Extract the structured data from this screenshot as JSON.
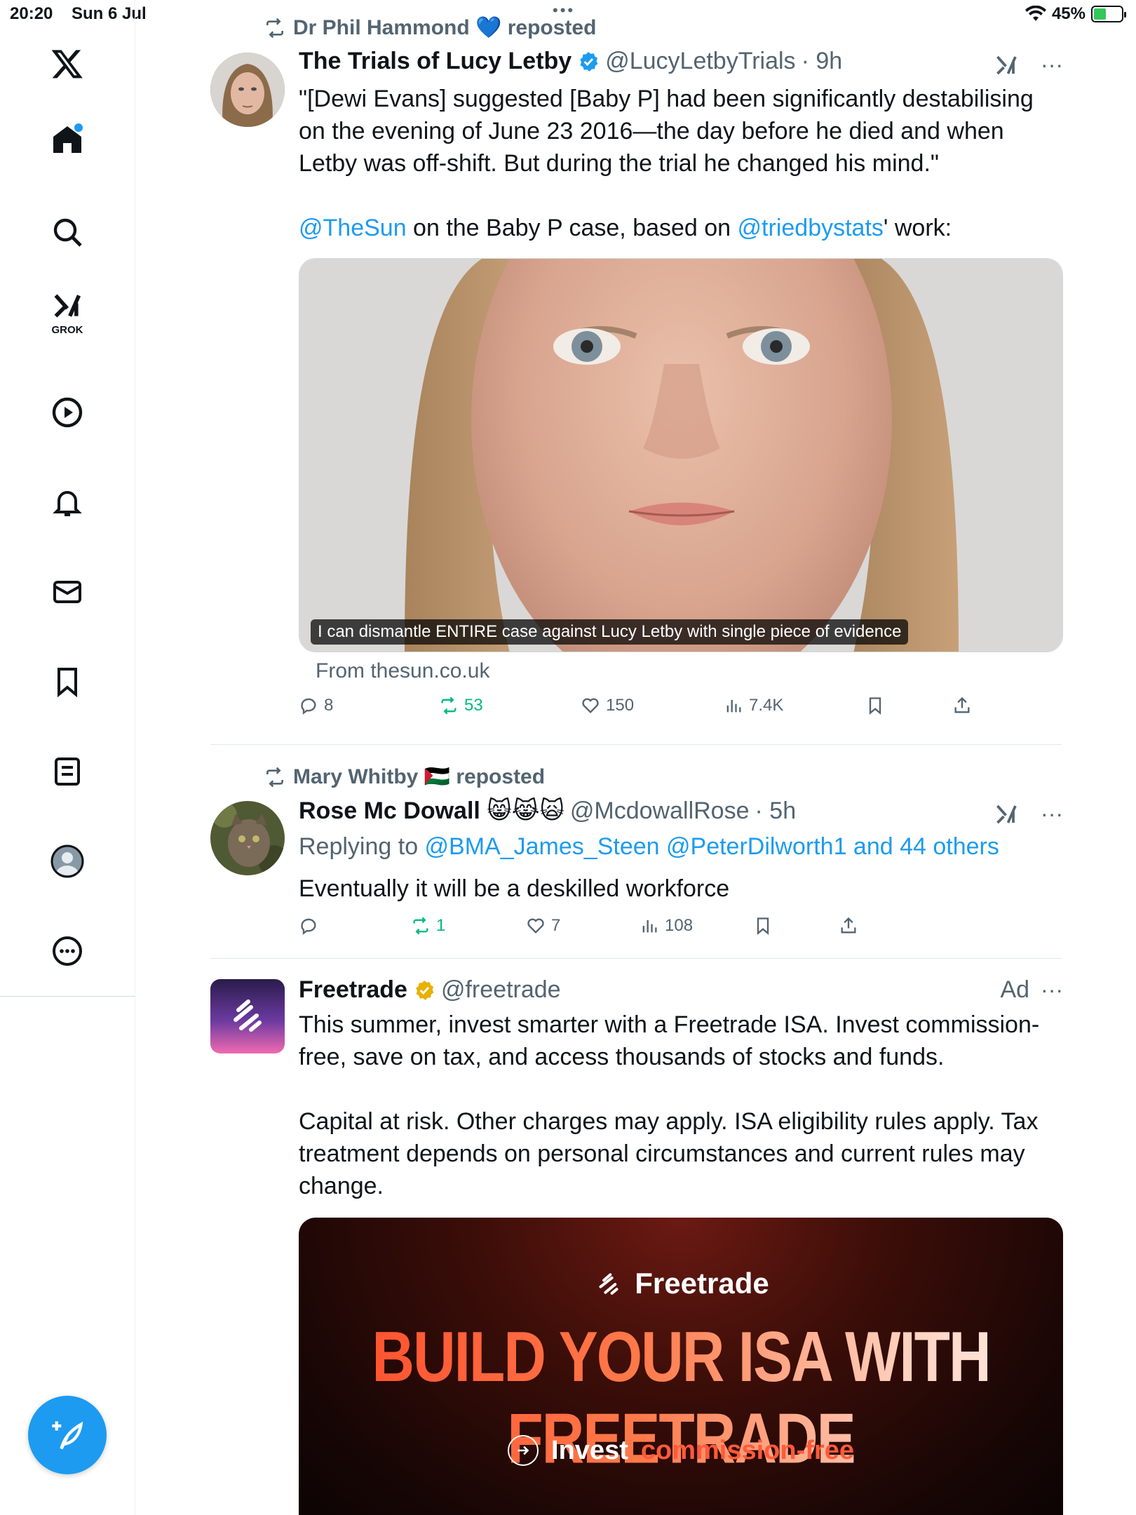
{
  "status_bar": {
    "time": "20:20",
    "date": "Sun 6 Jul",
    "battery": "45%",
    "battery_level": 0.45
  },
  "sidebar": {
    "grok_label": "GROK"
  },
  "tweets": [
    {
      "reposted_by": "Dr Phil Hammond 💙 reposted",
      "name": "The Trials of Lucy Letby",
      "handle": "@LucyLetbyTrials",
      "time": "· 9h",
      "text_line1": "\"[Dewi Evans] suggested [Baby P] had been significantly destabilising on the evening of June 23 2016—the day before he died and when Letby was off-shift. But during the trial he changed his mind.\"",
      "mention1": "@TheSun",
      "text_mid": " on the Baby P case, based on ",
      "mention2": "@triedbystats",
      "text_end": "' work:",
      "media_caption": "I can dismantle ENTIRE case against Lucy Letby with single piece of evidence",
      "from": "From thesun.co.uk",
      "replies": "8",
      "reposts": "53",
      "likes": "150",
      "views": "7.4K"
    },
    {
      "reposted_by": "Mary Whitby 🇵🇸 reposted",
      "name": "Rose Mc Dowall 😸😹🙀",
      "handle": "@McdowallRose",
      "time": "· 5h",
      "replying_prefix": "Replying to ",
      "replying_to": "@BMA_James_Steen @PeterDilworth1 and 44 others",
      "text": "Eventually it will be a deskilled workforce",
      "replies": "",
      "reposts": "1",
      "likes": "7",
      "views": "108"
    },
    {
      "name": "Freetrade",
      "handle": "@freetrade",
      "ad": "Ad",
      "text1": "This summer, invest smarter with a Freetrade ISA. Invest commission-free, save on tax, and access thousands of stocks and funds.",
      "text2": "Capital at risk. Other charges may apply. ISA eligibility rules apply. Tax treatment depends on personal circumstances and current rules may change.",
      "banner_brand": "Freetrade",
      "banner_headline": "BUILD YOUR ISA WITH FREETRADE",
      "banner_cta_1": "Invest",
      "banner_cta_2": "commission-free"
    }
  ],
  "colors": {
    "accent": "#1d9bf0",
    "repost_green": "#00ba7c",
    "muted": "#536471"
  }
}
